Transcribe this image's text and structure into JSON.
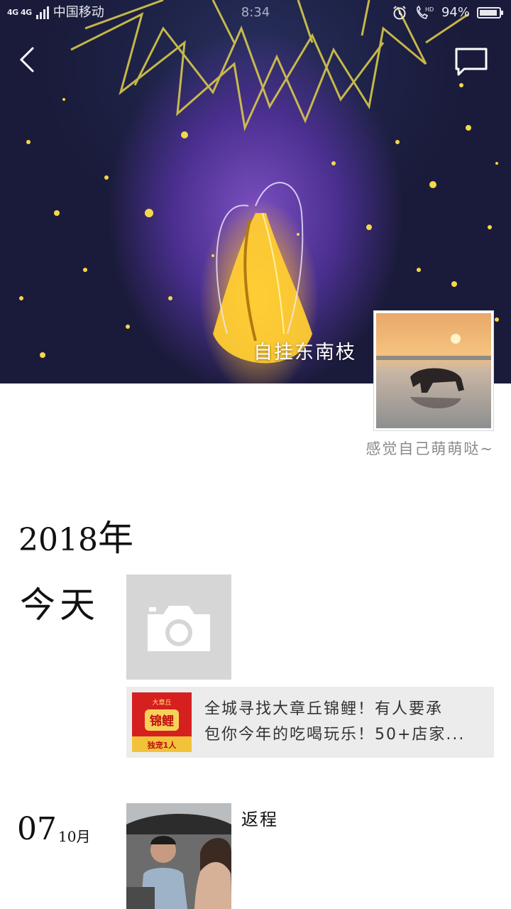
{
  "status_bar": {
    "network": "4G 4G",
    "carrier": "中国移动",
    "time": "8:34",
    "battery": "94%",
    "battery_level": 0.94,
    "icons": [
      "signal-icon",
      "alarm-icon",
      "hd-call-icon",
      "battery-icon"
    ]
  },
  "header": {
    "back_icon": "chevron-left-icon",
    "comment_icon": "message-bubble-icon"
  },
  "profile": {
    "nickname": "自挂东南枝",
    "signature": "感觉自己萌萌哒~"
  },
  "timeline": {
    "year": "2018",
    "year_unit": "年",
    "today_label": "今天",
    "camera_icon": "camera-icon",
    "share": {
      "thumb_top": "大章丘",
      "thumb_main": "锦鲤",
      "thumb_bottom": "独宠1人",
      "line1": "全城寻找大章丘锦鲤！有人要承",
      "line2": "包你今年的吃喝玩乐！50+店家..."
    },
    "post": {
      "day": "07",
      "month": "10月",
      "caption": "返程"
    }
  },
  "colors": {
    "cover_purple": "#4a2f8f",
    "cover_gold": "#ffd23c",
    "card_bg": "#ececec",
    "camera_tile_bg": "#d6d6d6",
    "share_thumb_red": "#d62020"
  }
}
